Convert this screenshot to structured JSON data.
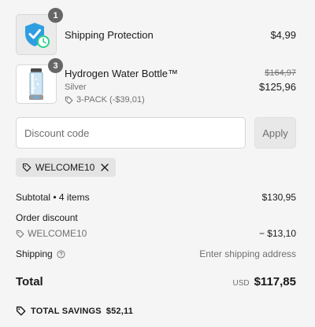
{
  "items": [
    {
      "quantity": "1",
      "name": "Shipping Protection",
      "price": "$4,99",
      "thumbnail_icon": "shield-check-icon"
    },
    {
      "quantity": "3",
      "name": "Hydrogen Water Bottle™",
      "variant": "Silver",
      "discount_label": "3-PACK (-$39,01)",
      "original_price": "$164,97",
      "price": "$125,96",
      "thumbnail_icon": "water-bottle-icon"
    }
  ],
  "discount": {
    "placeholder": "Discount code",
    "apply_label": "Apply",
    "applied_code": "WELCOME10"
  },
  "summary": {
    "subtotal_label": "Subtotal • 4 items",
    "subtotal_value": "$130,95",
    "order_discount_label": "Order discount",
    "order_discount_code": "WELCOME10",
    "order_discount_value": "− $13,10",
    "shipping_label": "Shipping",
    "shipping_value": "Enter shipping address",
    "total_label": "Total",
    "currency": "USD",
    "total_value": "$117,85",
    "savings_label": "TOTAL SAVINGS",
    "savings_value": "$52,11"
  },
  "colors": {
    "background": "#f5f5f5",
    "text": "#1a1a1a",
    "muted": "#707070",
    "shield_blue": "#2f9ee0",
    "check_green": "#2fd18a",
    "badge": "#666666"
  }
}
